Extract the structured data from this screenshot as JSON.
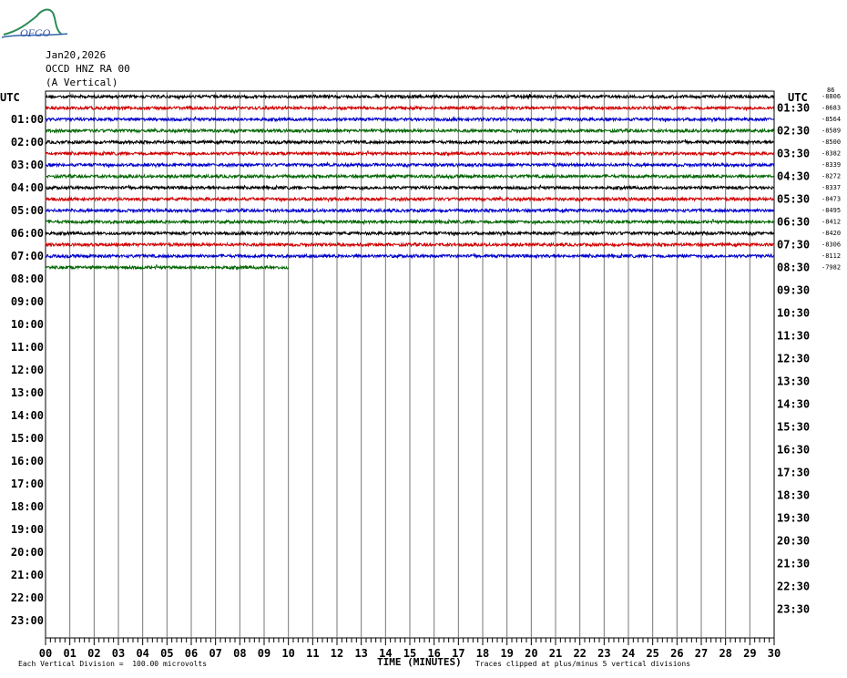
{
  "logo": {
    "text": "OFGO"
  },
  "header": {
    "date": "Jan20,2026",
    "station": "OCCD HNZ RA 00",
    "component": "(A Vertical)"
  },
  "chart_data": {
    "type": "line",
    "title": "",
    "xlabel": "TIME (MINUTES)",
    "ylabel": "",
    "xlim": [
      0,
      30
    ],
    "x_ticks": [
      "00",
      "01",
      "02",
      "03",
      "04",
      "05",
      "06",
      "07",
      "08",
      "09",
      "10",
      "11",
      "12",
      "13",
      "14",
      "15",
      "16",
      "17",
      "18",
      "19",
      "20",
      "21",
      "22",
      "23",
      "24",
      "25",
      "26",
      "27",
      "28",
      "29",
      "30"
    ],
    "left_utc_label": "UTC",
    "right_utc_label": "UTC",
    "left_hour_labels": [
      "01:00",
      "02:00",
      "03:00",
      "04:00",
      "05:00",
      "06:00",
      "07:00",
      "08:00",
      "09:00",
      "10:00",
      "11:00",
      "12:00",
      "13:00",
      "14:00",
      "15:00",
      "16:00",
      "17:00",
      "18:00",
      "19:00",
      "20:00",
      "21:00",
      "22:00",
      "23:00"
    ],
    "right_hour_labels": [
      "01:30",
      "02:30",
      "03:30",
      "04:30",
      "05:30",
      "06:30",
      "07:30",
      "08:30",
      "09:30",
      "10:30",
      "11:30",
      "12:30",
      "13:30",
      "14:30",
      "15:30",
      "16:30",
      "17:30",
      "18:30",
      "19:30",
      "20:30",
      "21:30",
      "22:30",
      "23:30"
    ],
    "trace_colors": [
      "#000000",
      "#d00000",
      "#0000cc",
      "#006600"
    ],
    "traces": [
      {
        "row": 0,
        "start_min": 0,
        "end_min": 30,
        "offset": "-8806"
      },
      {
        "row": 1,
        "start_min": 0,
        "end_min": 30,
        "offset": "-8683"
      },
      {
        "row": 2,
        "start_min": 0,
        "end_min": 30,
        "offset": "-8564"
      },
      {
        "row": 3,
        "start_min": 0,
        "end_min": 30,
        "offset": "-8589"
      },
      {
        "row": 4,
        "start_min": 0,
        "end_min": 30,
        "offset": "-8500"
      },
      {
        "row": 5,
        "start_min": 0,
        "end_min": 30,
        "offset": "-8382"
      },
      {
        "row": 6,
        "start_min": 0,
        "end_min": 30,
        "offset": "-8339"
      },
      {
        "row": 7,
        "start_min": 0,
        "end_min": 30,
        "offset": "-8272"
      },
      {
        "row": 8,
        "start_min": 0,
        "end_min": 30,
        "offset": "-8337"
      },
      {
        "row": 9,
        "start_min": 0,
        "end_min": 30,
        "offset": "-8473"
      },
      {
        "row": 10,
        "start_min": 0,
        "end_min": 30,
        "offset": "-8495"
      },
      {
        "row": 11,
        "start_min": 0,
        "end_min": 30,
        "offset": "-8412"
      },
      {
        "row": 12,
        "start_min": 0,
        "end_min": 30,
        "offset": "-8420"
      },
      {
        "row": 13,
        "start_min": 0,
        "end_min": 30,
        "offset": "-8306"
      },
      {
        "row": 14,
        "start_min": 0,
        "end_min": 30,
        "offset": "-8112"
      },
      {
        "row": 15,
        "start_min": 0,
        "end_min": 10,
        "offset": "-7982"
      }
    ],
    "offset_top_label": "86",
    "grid": true
  },
  "footer": {
    "scale_note": "Each Vertical Division =  100.00 microvolts",
    "time_label": "TIME (MINUTES)",
    "clip_note": "Traces clipped at plus/minus 5 vertical divisions"
  }
}
